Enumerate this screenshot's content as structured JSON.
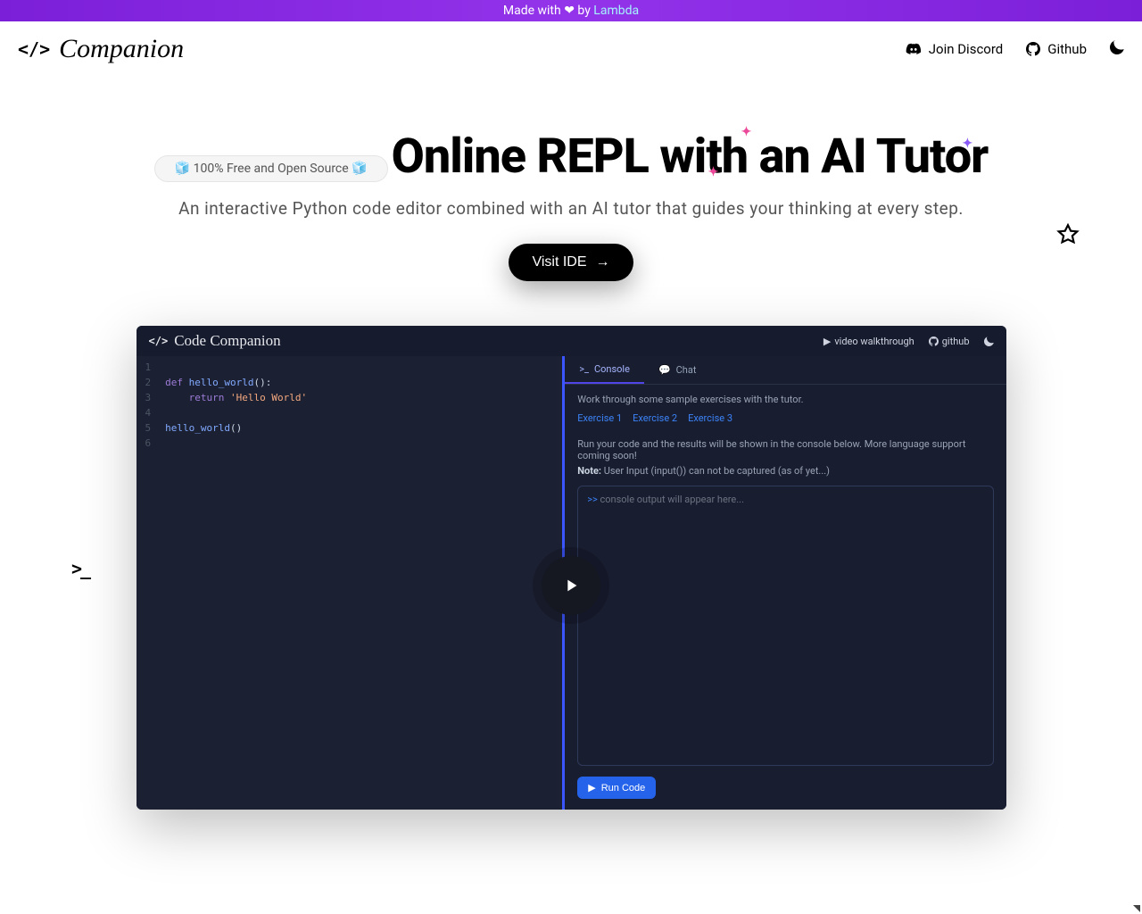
{
  "banner": {
    "prefix": "Made with ",
    "heart": "❤",
    "by": " by ",
    "link": "Lambda"
  },
  "nav": {
    "brand": "Companion",
    "discord": "Join Discord",
    "github": "Github"
  },
  "hero": {
    "pill": "🧊 100% Free and Open Source 🧊",
    "headline": "Online REPL with an AI Tutor",
    "subhead": "An interactive Python code editor combined with an AI tutor that guides your thinking at every step.",
    "cta": "Visit IDE",
    "arrow": "→"
  },
  "preview": {
    "brand": "Code Companion",
    "links": {
      "video": "video walkthrough",
      "github": "github"
    },
    "code_lines": [
      "1",
      "2",
      "3",
      "4",
      "5",
      "6"
    ],
    "code": {
      "l2a": "def ",
      "l2b": "hello_world",
      "l2c": "():",
      "l3a": "    return ",
      "l3b": "'Hello World'",
      "l5a": "hello_world",
      "l5b": "()"
    },
    "tabs": {
      "console": "Console",
      "chat": "Chat"
    },
    "hint": "Work through some sample exercises with the tutor.",
    "exercises": [
      "Exercise 1",
      "Exercise 2",
      "Exercise 3"
    ],
    "desc": "Run your code and the results will be shown in the console below. More language support coming soon!",
    "note_label": "Note:",
    "note_text": " User Input (input()) can not be captured (as of yet...)",
    "console_prompt": ">>",
    "console_placeholder": " console output will appear here...",
    "run": "Run Code"
  }
}
